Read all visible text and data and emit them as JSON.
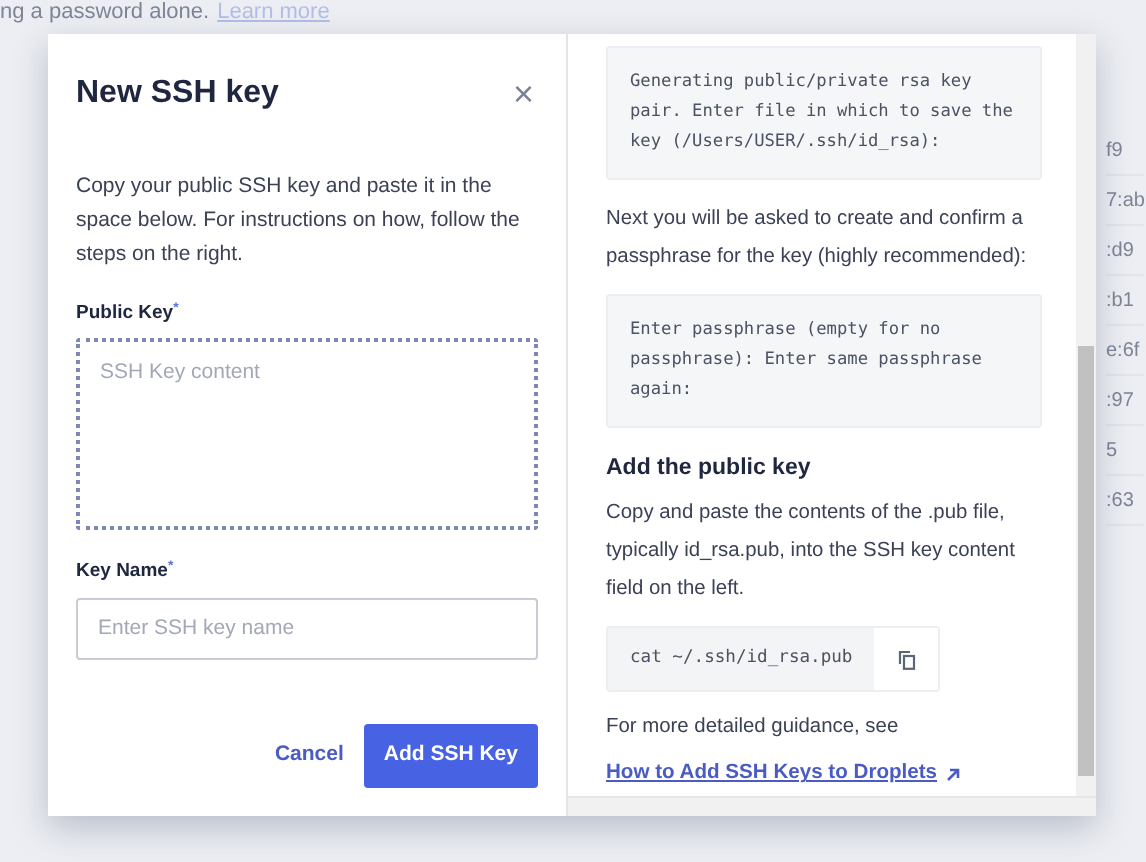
{
  "background": {
    "notice": "ng a password alone.",
    "link": "Learn more",
    "fragments": [
      "f9",
      "7:ab",
      ":d9",
      ":b1",
      "e:6f",
      ":97",
      "5",
      ":63"
    ]
  },
  "dialog": {
    "title": "New SSH key",
    "close": "×",
    "description": "Copy your public SSH key and paste it in the space below. For instructions on how, follow the steps on the right.",
    "fields": [
      {
        "label": "Public Key",
        "required": "*",
        "kind": "textarea",
        "placeholder": "SSH Key content",
        "focused": true
      },
      {
        "label": "Key Name",
        "required": "*",
        "kind": "input",
        "placeholder": "Enter SSH key name",
        "focused": false
      }
    ],
    "buttons": [
      {
        "label": "Cancel",
        "kind": "link"
      },
      {
        "label": "Add SSH Key",
        "kind": "primary"
      }
    ]
  },
  "instructions": [
    {
      "kind": "code",
      "text": "Generating public/private rsa key pair. Enter file in which to save the key (/Users/USER/.ssh/id_rsa):"
    },
    {
      "kind": "paragraph",
      "text": "Next you will be asked to create and confirm a passphrase for the key (highly recommended):"
    },
    {
      "kind": "code",
      "text": "Enter passphrase (empty for no passphrase): Enter same passphrase again:"
    },
    {
      "kind": "heading",
      "text": "Add the public key"
    },
    {
      "kind": "paragraph",
      "text": "Copy and paste the contents of the .pub file, typically id_rsa.pub, into the SSH key content field on the left."
    },
    {
      "kind": "command",
      "text": "cat ~/.ssh/id_rsa.pub"
    },
    {
      "kind": "paragraph",
      "text": "For more detailed guidance, see"
    },
    {
      "kind": "link",
      "text": "How to Add SSH Keys to Droplets"
    }
  ]
}
